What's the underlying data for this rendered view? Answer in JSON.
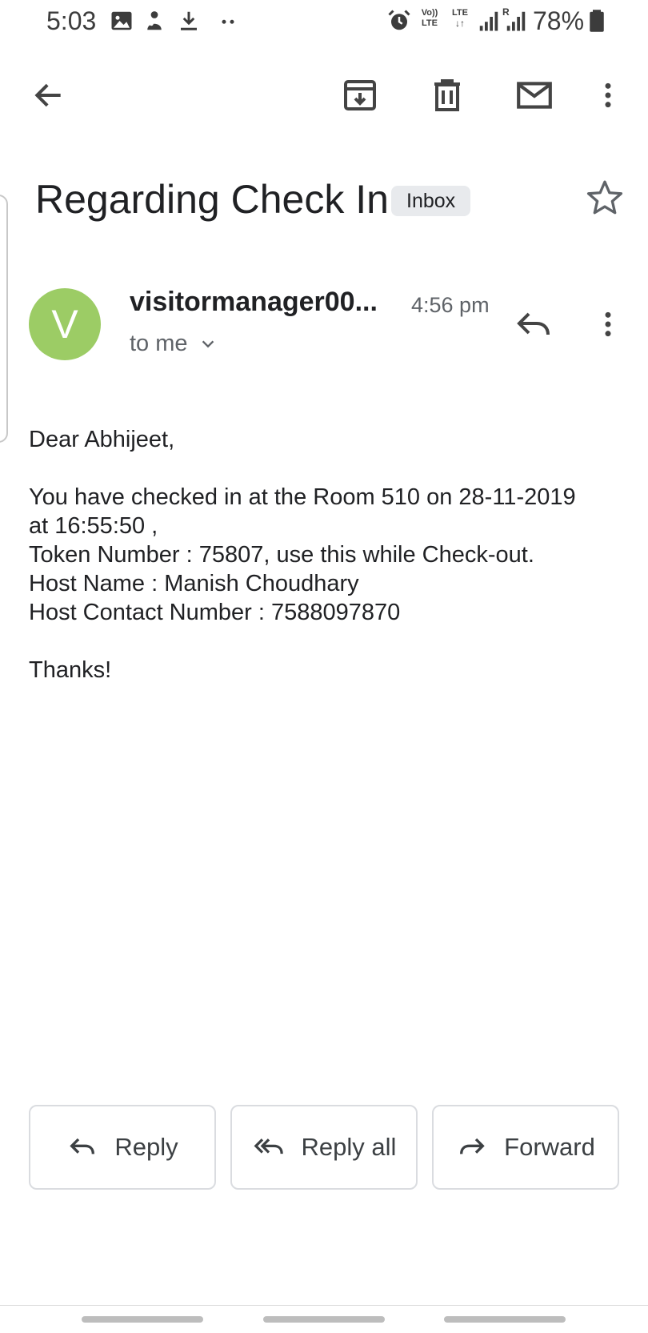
{
  "status_bar": {
    "time": "5:03",
    "icons": [
      "image-icon",
      "person-notification-icon",
      "download-icon",
      "more-dots-icon"
    ],
    "right_icons": [
      "alarm-icon",
      "volte-icon",
      "lte-data-icon",
      "signal-icon",
      "roaming-signal-icon",
      "battery-icon"
    ],
    "volte_line1": "Vo))",
    "volte_line2": "LTE",
    "lte_label": "LTE",
    "roaming_label": "R",
    "battery_percent": "78%"
  },
  "app_bar": {
    "icons": [
      "back-arrow-icon",
      "archive-icon",
      "delete-icon",
      "mark-unread-icon",
      "more-vert-icon"
    ]
  },
  "email": {
    "subject": "Regarding Check In",
    "label": "Inbox",
    "sender": {
      "avatar_letter": "V",
      "avatar_color": "#9ccc65",
      "name": "visitormanager00...",
      "time": "4:56 pm",
      "recipient": "to me"
    },
    "body": {
      "greeting": "Dear Abhijeet,",
      "line1": "You have checked in at the Room 510 on 28-11-2019",
      "line2": "at 16:55:50 ,",
      "line3": "Token Number : 75807, use this while Check-out.",
      "line4": "Host Name : Manish Choudhary",
      "line5": "Host Contact Number : 7588097870",
      "closing": "Thanks!"
    }
  },
  "actions": {
    "reply": "Reply",
    "reply_all": "Reply all",
    "forward": "Forward"
  }
}
